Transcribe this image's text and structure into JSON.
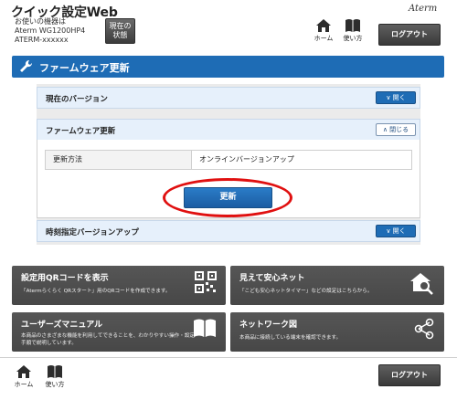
{
  "header": {
    "app_title": "クイック設定Web",
    "device_line1": "お使いの機器は",
    "device_line2": "Aterm WG1200HP4",
    "device_line3": "ATERM-xxxxxx",
    "status_button_line1": "現在の",
    "status_button_line2": "状態",
    "brand": "Aterm",
    "home_label": "ホーム",
    "manual_label": "使い方",
    "logout_label": "ログアウト"
  },
  "banner": {
    "title": "ファームウェア更新",
    "icon": "wrench-icon"
  },
  "sections": {
    "current_version": {
      "label": "現在のバージョン",
      "button": "開く"
    },
    "firmware_update": {
      "label": "ファームウェア更新",
      "button": "閉じる"
    },
    "scheduled_update": {
      "label": "時刻指定バージョンアップ",
      "button": "開く"
    }
  },
  "update_method": {
    "key": "更新方法",
    "value": "オンラインバージョンアップ"
  },
  "update_button": "更新",
  "tiles": [
    {
      "title": "設定用QRコードを表示",
      "desc": "「Atermらくらく QRスタート」用のQRコードを作成できます。",
      "icon": "qr-code-icon"
    },
    {
      "title": "見えて安心ネット",
      "desc": "「こども安心ネットタイマー」などの設定はこちらから。",
      "icon": "house-search-icon"
    },
    {
      "title": "ユーザーズマニュアル",
      "desc": "本商品のさまざまな機能を利用してできることを、わかりやすい操作・設定手順で説明しています。",
      "icon": "book-icon"
    },
    {
      "title": "ネットワーク図",
      "desc": "本商品に接続している端末を確認できます。",
      "icon": "network-icon"
    }
  ],
  "footer": {
    "home_label": "ホーム",
    "manual_label": "使い方",
    "logout_label": "ログアウト"
  },
  "colors": {
    "primary_blue": "#1e6cb5",
    "tile_gray": "#4e4e4e",
    "highlight_red": "#e01010"
  }
}
